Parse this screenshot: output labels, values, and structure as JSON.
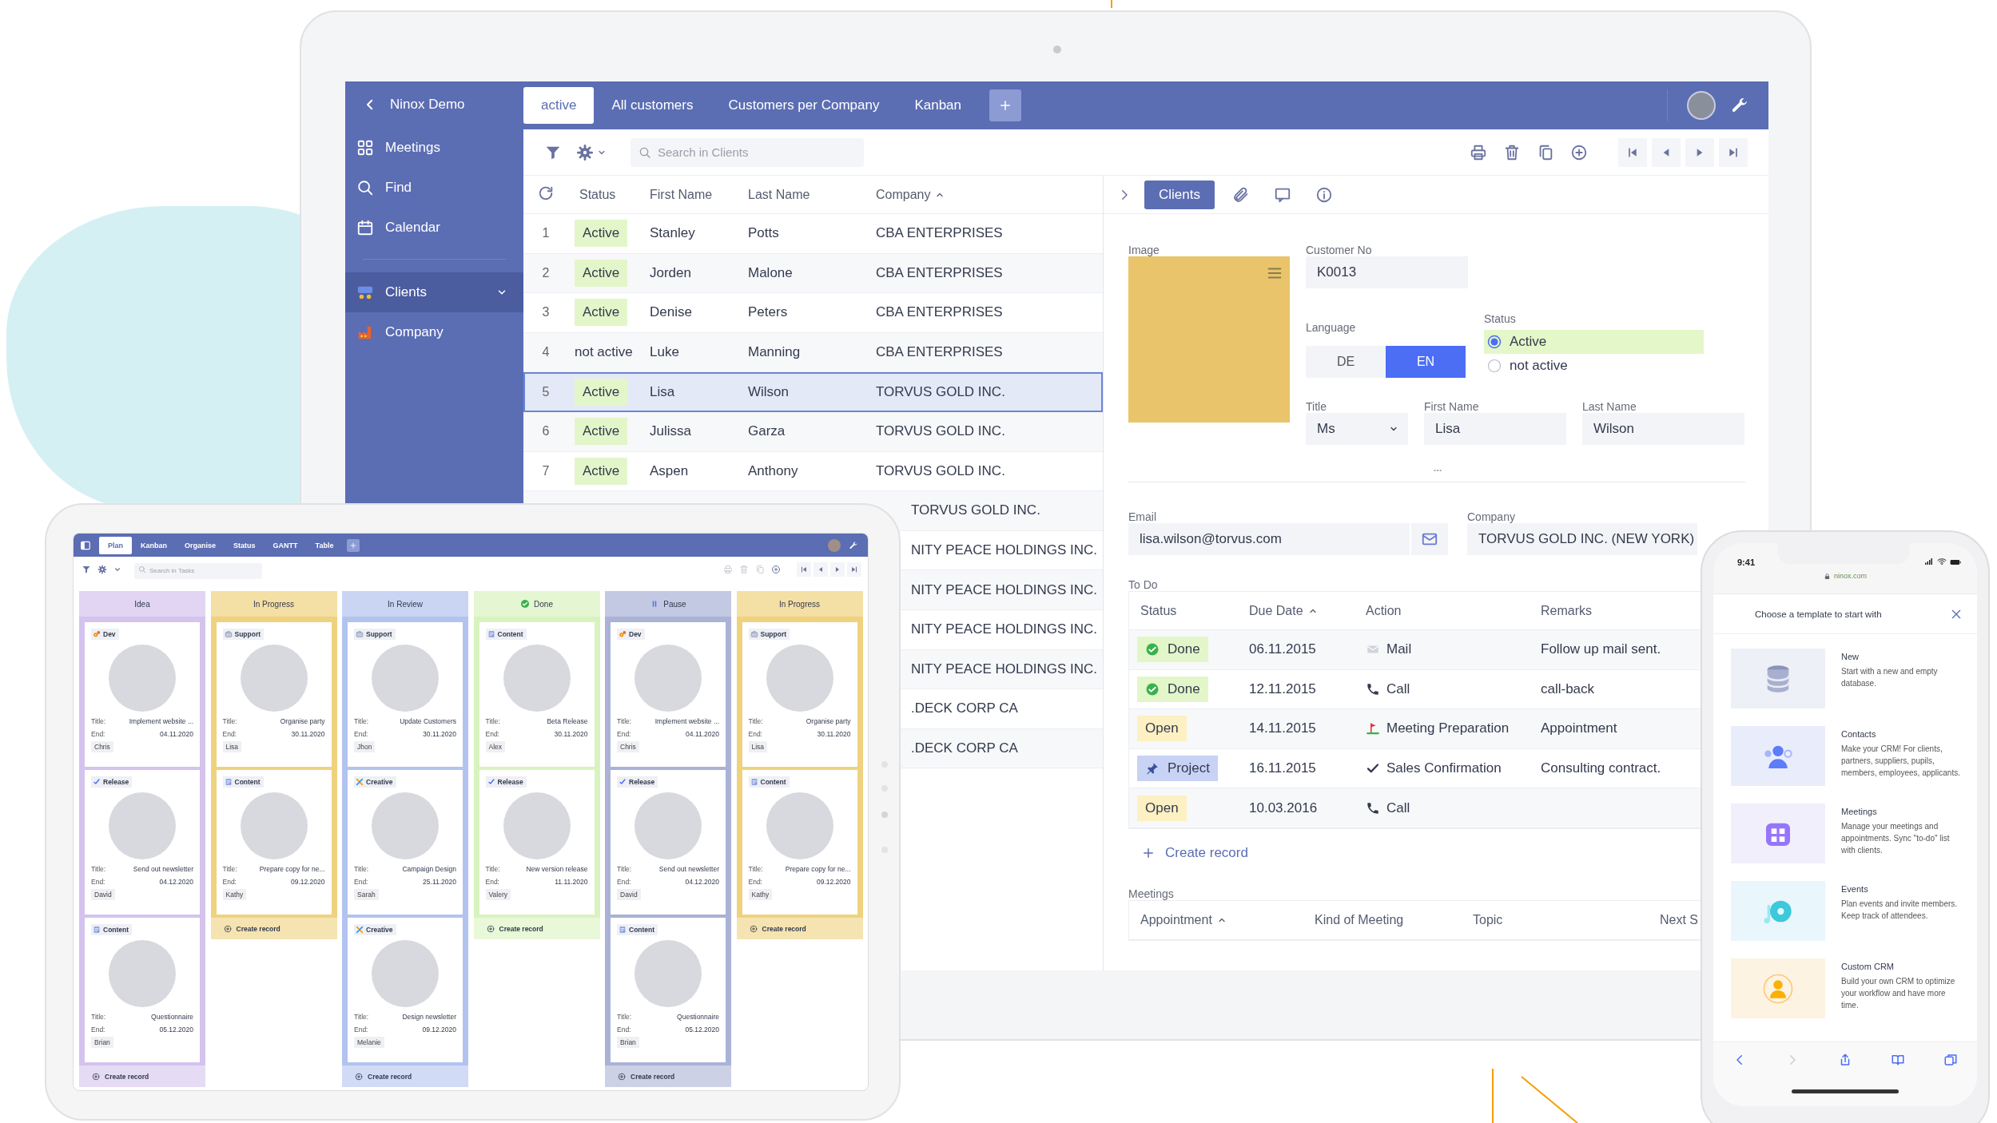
{
  "laptop": {
    "sidebar": {
      "back": "Ninox Demo",
      "items": [
        {
          "label": "Meetings",
          "kind": "nav",
          "selected": false
        },
        {
          "label": "Find",
          "kind": "nav",
          "selected": false
        },
        {
          "label": "Calendar",
          "kind": "nav",
          "selected": false
        },
        {
          "label": "Clients",
          "kind": "table",
          "selected": true
        },
        {
          "label": "Company",
          "kind": "table",
          "selected": false
        }
      ]
    },
    "tabs": [
      {
        "label": "active",
        "selected": true
      },
      {
        "label": "All customers",
        "selected": false
      },
      {
        "label": "Customers per Company",
        "selected": false
      },
      {
        "label": "Kanban",
        "selected": false
      }
    ],
    "search_placeholder": "Search in Clients",
    "table": {
      "columns": [
        {
          "label": "Status",
          "sorted": false
        },
        {
          "label": "First Name",
          "sorted": false
        },
        {
          "label": "Last Name",
          "sorted": false
        },
        {
          "label": "Company",
          "sorted": true
        }
      ],
      "rows": [
        {
          "kind": "full",
          "number": "1",
          "status": "Active",
          "active": true,
          "first_name": "Stanley",
          "last_name": "Potts",
          "company": "CBA ENTERPRISES",
          "selected": false
        },
        {
          "kind": "full",
          "number": "2",
          "status": "Active",
          "active": true,
          "first_name": "Jorden",
          "last_name": "Malone",
          "company": "CBA ENTERPRISES",
          "selected": false
        },
        {
          "kind": "full",
          "number": "3",
          "status": "Active",
          "active": true,
          "first_name": "Denise",
          "last_name": "Peters",
          "company": "CBA ENTERPRISES",
          "selected": false
        },
        {
          "kind": "full",
          "number": "4",
          "status": "not active",
          "active": false,
          "first_name": "Luke",
          "last_name": "Manning",
          "company": "CBA ENTERPRISES",
          "selected": false
        },
        {
          "kind": "full",
          "number": "5",
          "status": "Active",
          "active": true,
          "first_name": "Lisa",
          "last_name": "Wilson",
          "company": "TORVUS GOLD INC.",
          "selected": true
        },
        {
          "kind": "full",
          "number": "6",
          "status": "Active",
          "active": true,
          "first_name": "Julissa",
          "last_name": "Garza",
          "company": "TORVUS GOLD INC.",
          "selected": false
        },
        {
          "kind": "full",
          "number": "7",
          "status": "Active",
          "active": true,
          "first_name": "Aspen",
          "last_name": "Anthony",
          "company": "TORVUS GOLD INC.",
          "selected": false
        },
        {
          "kind": "covered",
          "company": "TORVUS GOLD INC.",
          "selected": false
        },
        {
          "kind": "covered",
          "company": "NITY PEACE HOLDINGS INC.",
          "selected": false
        },
        {
          "kind": "covered",
          "company": "NITY PEACE HOLDINGS INC.",
          "selected": false
        },
        {
          "kind": "covered",
          "company": "NITY PEACE HOLDINGS INC.",
          "selected": false
        },
        {
          "kind": "covered",
          "company": "NITY PEACE HOLDINGS INC.",
          "selected": false
        },
        {
          "kind": "covered",
          "company": ".DECK CORP CA",
          "selected": false
        },
        {
          "kind": "covered",
          "company": ".DECK CORP CA",
          "selected": false
        }
      ]
    },
    "detail": {
      "tabs": [
        {
          "label": "Clients",
          "selected": true
        }
      ],
      "image_label": "Image",
      "customer_no": {
        "label": "Customer No",
        "value": "K0013"
      },
      "language": {
        "label": "Language",
        "options": [
          {
            "label": "DE",
            "selected": false
          },
          {
            "label": "EN",
            "selected": true
          }
        ]
      },
      "status": {
        "label": "Status",
        "options": [
          {
            "label": "Active",
            "selected": true
          },
          {
            "label": "not active",
            "selected": false
          }
        ]
      },
      "title": {
        "label": "Title",
        "value": "Ms"
      },
      "first_name": {
        "label": "First Name",
        "value": "Lisa"
      },
      "last_name": {
        "label": "Last Name",
        "value": "Wilson"
      },
      "email": {
        "label": "Email",
        "value": "lisa.wilson@torvus.com"
      },
      "company": {
        "label": "Company",
        "value": "TORVUS GOLD INC. (NEW YORK)"
      },
      "todo": {
        "label": "To Do",
        "columns": [
          {
            "label": "Status",
            "sorted": false
          },
          {
            "label": "Due Date",
            "sorted": true
          },
          {
            "label": "Action",
            "sorted": false
          },
          {
            "label": "Remarks",
            "sorted": false
          }
        ],
        "rows": [
          {
            "status": "Done",
            "kind": "done",
            "due_date": "06.11.2015",
            "action": "Mail",
            "remarks": "Follow up mail sent."
          },
          {
            "status": "Done",
            "kind": "done",
            "due_date": "12.11.2015",
            "action": "Call",
            "remarks": "call-back"
          },
          {
            "status": "Open",
            "kind": "open",
            "due_date": "14.11.2015",
            "action": "Meeting Preparation",
            "remarks": "Appointment"
          },
          {
            "status": "Project",
            "kind": "project",
            "due_date": "16.11.2015",
            "action": "Sales Confirmation",
            "remarks": "Consulting contract."
          },
          {
            "status": "Open",
            "kind": "open",
            "due_date": "10.03.2016",
            "action": "Call"
          }
        ],
        "create_label": "Create record"
      },
      "meetings": {
        "label": "Meetings",
        "columns": [
          {
            "label": "Appointment",
            "sorted": true
          },
          {
            "label": "Kind of Meeting",
            "sorted": false
          },
          {
            "label": "Topic",
            "sorted": false
          },
          {
            "label": "Next S",
            "sorted": false
          }
        ]
      }
    }
  },
  "tablet": {
    "tabs": [
      {
        "label": "Plan",
        "selected": true
      },
      {
        "label": "Kanban",
        "selected": false
      },
      {
        "label": "Organise",
        "selected": false
      },
      {
        "label": "Status",
        "selected": false
      },
      {
        "label": "GANTT",
        "selected": false
      },
      {
        "label": "Table",
        "selected": false
      }
    ],
    "search_placeholder": "Search in Tasks",
    "actions_disabled": true,
    "columns": [
      {
        "title": "Idea",
        "kind": "plain",
        "color": "#d4c3ee",
        "create_label": "Create record",
        "cards": [
          {
            "kind": "dev",
            "tag": "Dev",
            "title_label": "Title:",
            "title": "Implement website ...",
            "end_label": "End:",
            "end": "04.11.2020",
            "person": "Chris"
          },
          {
            "kind": "release",
            "tag": "Release",
            "title_label": "Title:",
            "title": "Send out newsletter",
            "end_label": "End:",
            "end": "04.12.2020",
            "person": "David"
          },
          {
            "kind": "content",
            "tag": "Content",
            "title_label": "Title:",
            "title": "Questionnaire",
            "end_label": "End:",
            "end": "05.12.2020",
            "person": "Brian"
          }
        ]
      },
      {
        "title": "In Progress",
        "kind": "plain",
        "color": "#efd27e",
        "create_label": "Create record",
        "cards": [
          {
            "kind": "support",
            "tag": "Support",
            "title_label": "Title:",
            "title": "Organise party",
            "end_label": "End:",
            "end": "30.11.2020",
            "person": "Lisa"
          },
          {
            "kind": "content",
            "tag": "Content",
            "title_label": "Title:",
            "title": "Prepare copy for ne...",
            "end_label": "End:",
            "end": "09.12.2020",
            "person": "Kathy"
          }
        ]
      },
      {
        "title": "In Review",
        "kind": "plain",
        "color": "#b3c3ef",
        "create_label": "Create record",
        "cards": [
          {
            "kind": "support",
            "tag": "Support",
            "title_label": "Title:",
            "title": "Update Customers",
            "end_label": "End:",
            "end": "30.11.2020",
            "person": "Jhon"
          },
          {
            "kind": "creative",
            "tag": "Creative",
            "title_label": "Title:",
            "title": "Campaign Design",
            "end_label": "End:",
            "end": "25.11.2020",
            "person": "Sarah"
          },
          {
            "kind": "creative",
            "tag": "Creative",
            "title_label": "Title:",
            "title": "Design newsletter",
            "end_label": "End:",
            "end": "09.12.2020",
            "person": "Melanie"
          }
        ]
      },
      {
        "title": "Done",
        "kind": "done",
        "color": "#d9f3bf",
        "create_label": "Create record",
        "cards": [
          {
            "kind": "content",
            "tag": "Content",
            "title_label": "Title:",
            "title": "Beta Release",
            "end_label": "End:",
            "end": "30.11.2020",
            "person": "Alex"
          },
          {
            "kind": "release",
            "tag": "Release",
            "title_label": "Title:",
            "title": "New version release",
            "end_label": "End:",
            "end": "11.11.2020",
            "person": "Valery"
          }
        ]
      },
      {
        "title": "Pause",
        "kind": "pause",
        "color": "#aab2d6",
        "create_label": "Create record",
        "cards": [
          {
            "kind": "dev",
            "tag": "Dev",
            "title_label": "Title:",
            "title": "Implement website ...",
            "end_label": "End:",
            "end": "04.11.2020",
            "person": "Chris"
          },
          {
            "kind": "release",
            "tag": "Release",
            "title_label": "Title:",
            "title": "Send out newsletter",
            "end_label": "End:",
            "end": "04.12.2020",
            "person": "David"
          },
          {
            "kind": "content",
            "tag": "Content",
            "title_label": "Title:",
            "title": "Questionnaire",
            "end_label": "End:",
            "end": "05.12.2020",
            "person": "Brian"
          }
        ]
      },
      {
        "title": "In Progress",
        "kind": "plain",
        "color": "#efd27e",
        "create_label": "Create record",
        "cards": [
          {
            "kind": "support",
            "tag": "Support",
            "title_label": "Title:",
            "title": "Organise party",
            "end_label": "End:",
            "end": "30.11.2020",
            "person": "Lisa"
          },
          {
            "kind": "content",
            "tag": "Content",
            "title_label": "Title:",
            "title": "Prepare copy for ne...",
            "end_label": "End:",
            "end": "09.12.2020",
            "person": "Kathy"
          }
        ]
      }
    ]
  },
  "phone": {
    "time": "9:41",
    "url": "ninox.com",
    "title": "Choose a template to start with",
    "forward_disabled": true,
    "templates": [
      {
        "title": "New",
        "description": "Start with a new and empty database.",
        "color": "#eef0f7"
      },
      {
        "title": "Contacts",
        "description": "Make your CRM! For clients, partners, suppliers, pupils, members, employees, applicants.",
        "color": "#e9edfb"
      },
      {
        "title": "Meetings",
        "description": "Manage your meetings and appointments. Sync \"to-do\" list with clients.",
        "color": "#f1effb"
      },
      {
        "title": "Events",
        "description": "Plan events and invite members. Keep track of attendees.",
        "color": "#e9f6fb"
      },
      {
        "title": "Custom CRM",
        "description": "Build your own CRM to optimize your workflow and have more time.",
        "color": "#fdf3e2"
      }
    ]
  }
}
